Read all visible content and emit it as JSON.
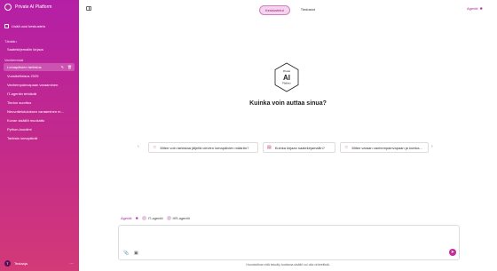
{
  "app": {
    "title": "Private AI Platform"
  },
  "sidebar": {
    "new_chat": "Lisää uusi keskustelu",
    "sections": [
      {
        "label": "Tänään",
        "items": [
          "Saatekirjemallin kirjaus"
        ]
      },
      {
        "label": "Vanhemmat",
        "items": [
          "Lomapäivien tarkistus",
          "Vuosikellolaus 2025",
          "Vanhempainvapaan varaaminen",
          "IT-agentin tehtävät",
          "Tiedon suoritus",
          "Neuvottelutuloksen varaaminen m...",
          "Kuvan sisällöt muokattu",
          "Python-koodimi",
          "Tarkista lomapäivät"
        ]
      }
    ],
    "user": {
      "initial": "T",
      "name": "Testaaja"
    }
  },
  "top": {
    "tabs": [
      "Keskustelut",
      "Tiedostot"
    ],
    "active_tab": 0,
    "agent_label": "Agentit"
  },
  "center": {
    "logo_text": "AI",
    "logo_small_top": "Private",
    "logo_small_bottom": "Platform",
    "question": "Kuinka voin auttaa sinua?",
    "suggestions": [
      "Miten voin tarkistaa jäljellä olevien lomapäivien määrän?",
      "Kuinka kirjaan saatekirjamallin?",
      "Miten varaan vanhempainvapaan ja kuinka..."
    ]
  },
  "agents": {
    "label": "Agentit",
    "items": [
      "IT-agentti",
      "HR-agentti"
    ]
  },
  "disclaimer": "Huomioithan että tekoäly tuottama sisältö voi olla virheellistä.",
  "colors": {
    "brand": "#b31fa2",
    "sidebar_top": "#b41fa6",
    "sidebar_bottom": "#d23a78"
  }
}
